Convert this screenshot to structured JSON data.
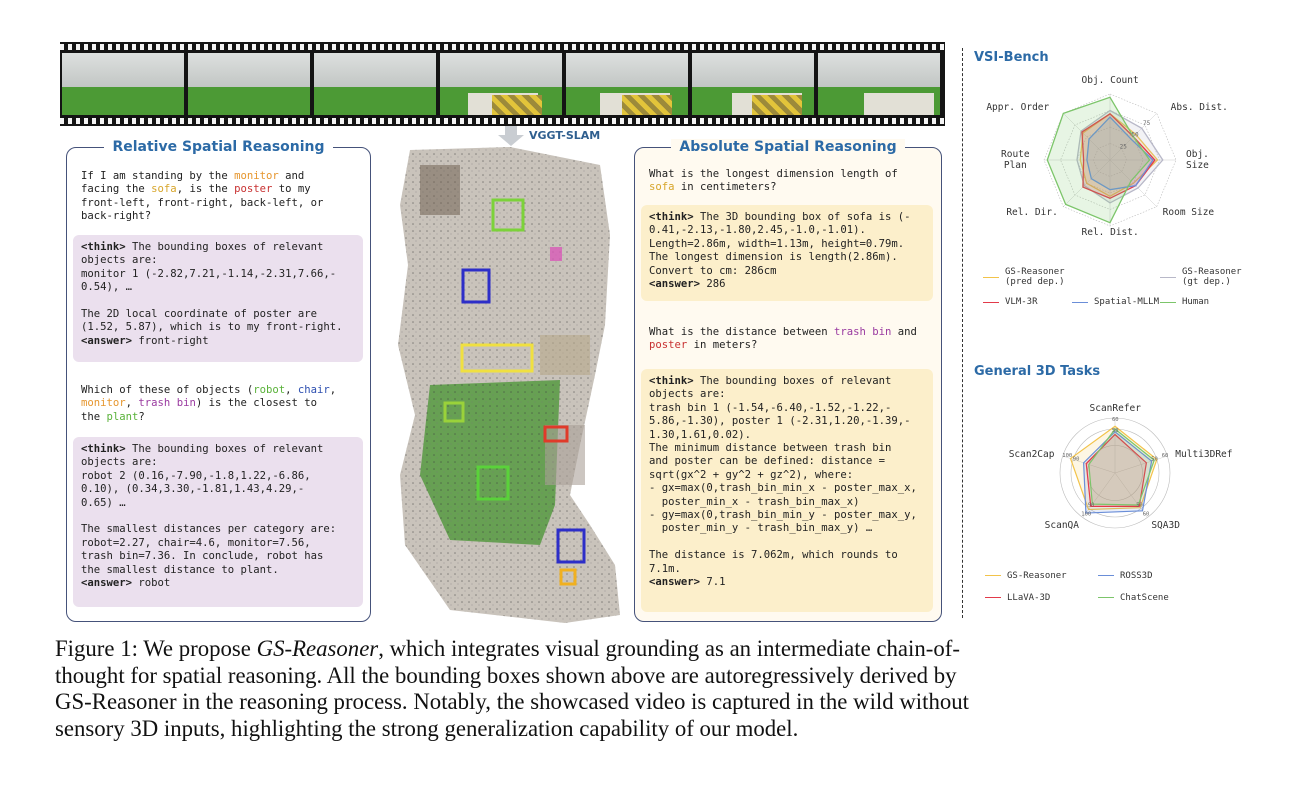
{
  "filmstrip": {
    "frames": 7
  },
  "arrow_label": "VGGT-SLAM",
  "left_panel": {
    "title": "Relative Spatial Reasoning",
    "q1": [
      [
        [
          "If I am standing by the ",
          ""
        ],
        [
          "monitor",
          "orange"
        ],
        [
          " and",
          ""
        ]
      ],
      [
        [
          "facing the ",
          ""
        ],
        [
          "sofa",
          "gold"
        ],
        [
          ", is the ",
          ""
        ],
        [
          "poster",
          "red"
        ],
        [
          " to my",
          ""
        ]
      ],
      [
        [
          "front-left, front-right, back-left, or",
          ""
        ]
      ],
      [
        [
          "back-right?",
          ""
        ]
      ]
    ],
    "a1": [
      [
        [
          "<think>",
          "bold"
        ],
        [
          " The bounding boxes of relevant",
          ""
        ]
      ],
      [
        [
          "objects are:",
          ""
        ]
      ],
      [
        [
          "monitor 1 (-2.82,7.21,-1.14,-2.31,7.66,-",
          ""
        ]
      ],
      [
        [
          "0.54), …",
          ""
        ]
      ],
      [
        [
          "",
          ""
        ]
      ],
      [
        [
          "The 2D local coordinate of poster are",
          ""
        ]
      ],
      [
        [
          "(1.52, 5.87), which is to my front-right.",
          ""
        ]
      ],
      [
        [
          "<answer>",
          "bold"
        ],
        [
          " front-right",
          ""
        ]
      ]
    ],
    "q2": [
      [
        [
          "Which of these of objects (",
          ""
        ],
        [
          "robot",
          "green"
        ],
        [
          ", ",
          ""
        ],
        [
          "chair",
          "blue"
        ],
        [
          ",",
          ""
        ]
      ],
      [
        [
          "monitor",
          "orange"
        ],
        [
          ", ",
          ""
        ],
        [
          "trash bin",
          "purple"
        ],
        [
          ") is the closest to",
          ""
        ]
      ],
      [
        [
          "the ",
          ""
        ],
        [
          "plant",
          "green"
        ],
        [
          "?",
          ""
        ]
      ]
    ],
    "a2": [
      [
        [
          "<think>",
          "bold"
        ],
        [
          " The bounding boxes of relevant",
          ""
        ]
      ],
      [
        [
          "objects are:",
          ""
        ]
      ],
      [
        [
          "robot 2 (0.16,-7.90,-1.8,1.22,-6.86,",
          ""
        ]
      ],
      [
        [
          "0.10), (0.34,3.30,-1.81,1.43,4.29,-",
          ""
        ]
      ],
      [
        [
          "0.65) …",
          ""
        ]
      ],
      [
        [
          "",
          ""
        ]
      ],
      [
        [
          "The smallest distances per category are:",
          ""
        ]
      ],
      [
        [
          "robot=2.27, chair=4.6, monitor=7.56,",
          ""
        ]
      ],
      [
        [
          "trash bin=7.36. In conclude, robot has",
          ""
        ]
      ],
      [
        [
          "the smallest distance to plant.",
          ""
        ]
      ],
      [
        [
          "<answer>",
          "bold"
        ],
        [
          " robot",
          ""
        ]
      ]
    ]
  },
  "right_panel": {
    "title": "Absolute Spatial Reasoning",
    "q1": [
      [
        [
          "What is the longest dimension length of",
          ""
        ]
      ],
      [
        [
          "sofa",
          "gold"
        ],
        [
          " in centimeters?",
          ""
        ]
      ]
    ],
    "a1": [
      [
        [
          "<think>",
          "bold"
        ],
        [
          " The 3D bounding box of sofa is (-",
          ""
        ]
      ],
      [
        [
          "0.41,-2.13,-1.80,2.45,-1.0,-1.01).",
          ""
        ]
      ],
      [
        [
          "Length=2.86m, width=1.13m, height=0.79m.",
          ""
        ]
      ],
      [
        [
          "The longest dimension is length(2.86m).",
          ""
        ]
      ],
      [
        [
          "Convert to cm: 286cm",
          ""
        ]
      ],
      [
        [
          "<answer>",
          "bold"
        ],
        [
          " 286",
          ""
        ]
      ]
    ],
    "q2": [
      [
        [
          "What is the distance between ",
          ""
        ],
        [
          "trash bin",
          "purple"
        ],
        [
          " and",
          ""
        ]
      ],
      [
        [
          "poster",
          "red"
        ],
        [
          " in meters?",
          ""
        ]
      ]
    ],
    "a2": [
      [
        [
          "<think>",
          "bold"
        ],
        [
          " The bounding boxes of relevant",
          ""
        ]
      ],
      [
        [
          "objects are:",
          ""
        ]
      ],
      [
        [
          "trash bin 1 (-1.54,-6.40,-1.52,-1.22,-",
          ""
        ]
      ],
      [
        [
          "5.86,-1.30), poster 1 (-2.31,1.20,-1.39,-",
          ""
        ]
      ],
      [
        [
          "1.30,1.61,0.02).",
          ""
        ]
      ],
      [
        [
          "The minimum distance between trash bin",
          ""
        ]
      ],
      [
        [
          "and poster can be defined: distance =",
          ""
        ]
      ],
      [
        [
          "sqrt(gx^2 + gy^2 + gz^2), where:",
          ""
        ]
      ],
      [
        [
          "- gx=max(0,trash_bin_min_x - poster_max_x,",
          ""
        ]
      ],
      [
        [
          "  poster_min_x - trash_bin_max_x)",
          ""
        ]
      ],
      [
        [
          "- gy=max(0,trash_bin_min_y - poster_max_y,",
          ""
        ]
      ],
      [
        [
          "  poster_min_y - trash_bin_max_y) …",
          ""
        ]
      ],
      [
        [
          "",
          ""
        ]
      ],
      [
        [
          "The distance is 7.062m, which rounds to",
          ""
        ]
      ],
      [
        [
          "7.1m.",
          ""
        ]
      ],
      [
        [
          "<answer>",
          "bold"
        ],
        [
          " 7.1",
          ""
        ]
      ]
    ]
  },
  "colors": {
    "orange": "#e6962e",
    "gold": "#d7a52a",
    "red": "#c83232",
    "blue": "#2d4fb0",
    "green": "#5ab23a",
    "purple": "#9a3aa0"
  },
  "chart_data": [
    {
      "type": "radar",
      "title": "VSI-Bench",
      "axes": [
        "Obj. Count",
        "Abs. Dist.",
        "Obj. Size",
        "Room Size",
        "Rel. Dist.",
        "Rel. Dir.",
        "Route Plan",
        "Appr. Order"
      ],
      "rlim": [
        0,
        100
      ],
      "ticks": [
        25,
        50,
        75
      ],
      "series": [
        {
          "name": "GS-Reasoner\n(pred dep.)",
          "color": "#f2c34a",
          "values": [
            70,
            55,
            72,
            50,
            55,
            50,
            45,
            58
          ]
        },
        {
          "name": "GS-Reasoner\n(gt dep.)",
          "color": "#b8b8c8",
          "values": [
            75,
            68,
            80,
            60,
            65,
            55,
            50,
            62
          ]
        },
        {
          "name": "VLM-3R",
          "color": "#e23a4a",
          "values": [
            70,
            50,
            68,
            55,
            58,
            58,
            40,
            60
          ]
        },
        {
          "name": "Spatial-MLLM",
          "color": "#6a8ed8",
          "values": [
            65,
            45,
            65,
            55,
            45,
            40,
            35,
            45
          ]
        },
        {
          "name": "Human",
          "color": "#7cc56a",
          "values": [
            95,
            50,
            60,
            45,
            95,
            95,
            95,
            100
          ]
        }
      ]
    },
    {
      "type": "radar",
      "title": "General 3D Tasks",
      "axes": [
        "ScanRefer",
        "Multi3DRef",
        "SQA3D",
        "ScanQA",
        "Scan2Cap"
      ],
      "ticks": [
        {
          "ScanRefer": "60",
          "Multi3DRef": "60",
          "SQA3D": "60",
          "ScanQA": "100",
          "Scan2Cap": "100"
        },
        {
          "ScanRefer": "50",
          "Multi3DRef": "50",
          "SQA3D": "50",
          "ScanQA": "90",
          "Scan2Cap": "90"
        }
      ],
      "series": [
        {
          "name": "GS-Reasoner",
          "color": "#f2c34a",
          "values": [
            0.85,
            0.8,
            0.78,
            0.82,
            0.85
          ]
        },
        {
          "name": "ROSS3D",
          "color": "#6a8ed8",
          "values": [
            0.75,
            0.7,
            0.85,
            0.9,
            0.6
          ]
        },
        {
          "name": "LLaVA-3D",
          "color": "#e23a4a",
          "values": [
            0.7,
            0.6,
            0.75,
            0.75,
            0.55
          ]
        },
        {
          "name": "ChatScene",
          "color": "#7cc56a",
          "values": [
            0.8,
            0.75,
            0.72,
            0.7,
            0.5
          ]
        }
      ]
    }
  ],
  "caption": {
    "lines": [
      [
        "Figure 1: We propose ",
        "GS-Reasoner",
        ", which integrates visual grounding as an intermediate chain-of-"
      ],
      [
        "thought for spatial reasoning. All the bounding boxes shown above are autoregressively derived by"
      ],
      [
        "GS-Reasoner in the reasoning process. Notably, the showcased video is captured in the wild without"
      ],
      [
        "sensory 3D inputs, highlighting the strong generalization capability of our model."
      ]
    ]
  }
}
